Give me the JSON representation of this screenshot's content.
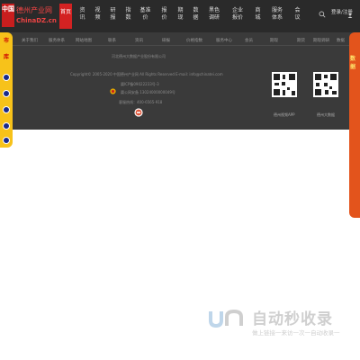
{
  "header": {
    "logo": {
      "seal_text": "中国",
      "cn_name": "德州产业网",
      "en_name": "ChinaDZ.cn"
    },
    "nav_items": [
      {
        "label": "首页",
        "active": true
      },
      {
        "label": "资讯"
      },
      {
        "label": "视频"
      },
      {
        "label": "研报"
      },
      {
        "label": "指数"
      },
      {
        "label": "基准价"
      },
      {
        "label": "报价"
      },
      {
        "label": "期现"
      },
      {
        "label": "数据"
      },
      {
        "label": "黑色调研"
      },
      {
        "label": "企业报价"
      },
      {
        "label": "商城"
      },
      {
        "label": "服务体系"
      },
      {
        "label": "会议"
      }
    ],
    "login_label": "登录/注册",
    "search_icon": "search-icon",
    "user_icon": "user-icon"
  },
  "footer": {
    "links": [
      "关于我们",
      "服务体系",
      "网站地图",
      "联系",
      "资讯",
      "研报",
      "价格指数",
      "服务中心",
      "会员",
      "期现",
      "期货",
      "期现调研",
      "数据"
    ],
    "company": "河北德州大数据产业股份有限公司",
    "copyright": "Copyright© 2005-2020 中国德州产业网 All Rights Reserved E-mail: info@chinatei.com",
    "icp": "冀ICP备09022233号-3",
    "police": "冀公网安备 13024000000049号",
    "hotline": "客服热线：400-6565-918",
    "qr_captions": [
      "德州视频APP",
      "德州大数据"
    ]
  },
  "left_ad": {
    "label_top": "市",
    "label_mid": "库"
  },
  "right_ad": {
    "label": "数据"
  },
  "watermark": {
    "title": "自动秒收录",
    "subtitle": "做上链接一来访一次一自动收录一"
  },
  "colors": {
    "topbar": "#2a2a2a",
    "footer": "#3a3a3a",
    "accent_red": "#d32222",
    "left_ad_yellow": "#f7c21a",
    "right_ad_orange": "#e3541c"
  }
}
